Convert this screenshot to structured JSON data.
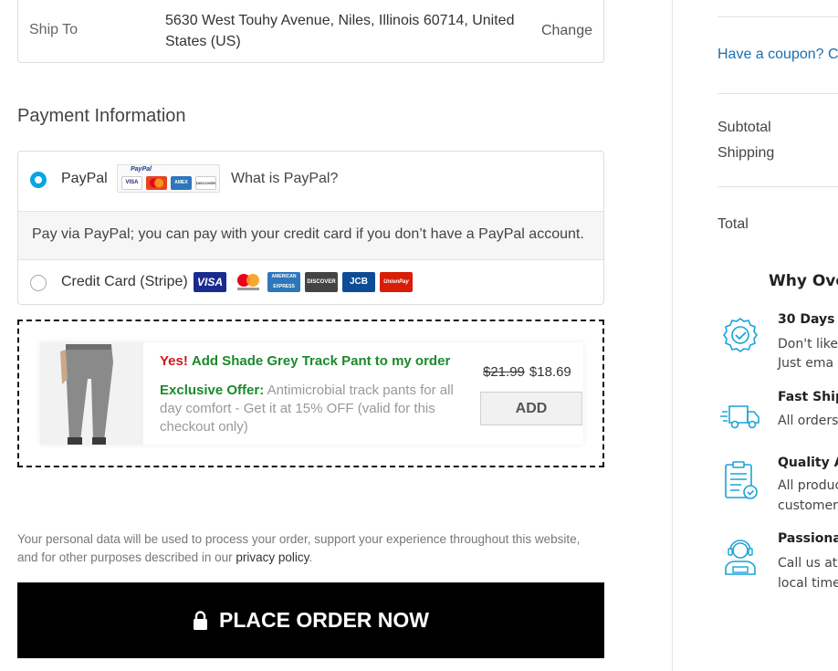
{
  "shipping": {
    "label": "Ship To",
    "address": "5630 West Touhy Avenue, Niles, Illinois 60714, United States (US)",
    "change_label": "Change"
  },
  "payment": {
    "title": "Payment Information",
    "paypal": {
      "label": "PayPal",
      "logo_text": "PayPal",
      "logo_cards": [
        "VISA",
        "MC",
        "AMEX",
        "DISCOVER"
      ],
      "what_is": "What is PayPal?",
      "selected": true,
      "description": "Pay via PayPal; you can pay with your credit card if you don’t have a PayPal account."
    },
    "credit_card": {
      "label": "Credit Card (Stripe)",
      "selected": false,
      "cards": [
        "VISA",
        "mastercard",
        "AMERICAN EXPRESS",
        "DISCOVER",
        "JCB",
        "UnionPay"
      ]
    }
  },
  "offer": {
    "yes": "Yes!",
    "headline": "Add Shade Grey Track Pant to my order",
    "exclusive_label": "Exclusive Offer:",
    "exclusive_text": "Antimicrobial track pants for all day comfort - Get it at 15% OFF (valid for this checkout only)",
    "old_price": "$21.99",
    "new_price": "$18.69",
    "add_label": "ADD"
  },
  "privacy": {
    "text": "Your personal data will be used to process your order, support your experience throughout this website, and for other purposes described in our ",
    "link": "privacy policy",
    "end": "."
  },
  "place_order": {
    "label": "PLACE ORDER NOW"
  },
  "sidebar": {
    "coupon": "Have a coupon? C",
    "subtotal": "Subtotal",
    "shipping": "Shipping",
    "total": "Total",
    "why_title": "Why Ove",
    "features": [
      {
        "icon": "award-badge-icon",
        "title": "30 Days S",
        "lines": [
          "Don't like",
          "Just ema"
        ]
      },
      {
        "icon": "delivery-truck-icon",
        "title": "Fast Ship",
        "lines": [
          "All orders"
        ]
      },
      {
        "icon": "clipboard-check-icon",
        "title": "Quality A",
        "lines": [
          "All produc",
          "customer"
        ]
      },
      {
        "icon": "support-agent-icon",
        "title": "Passiona",
        "lines": [
          "Call us at",
          "local time"
        ]
      }
    ]
  },
  "colors": {
    "accent_blue": "#0aa4e6",
    "link_blue": "#1a6fb0",
    "offer_green": "#1b8a2a",
    "offer_red": "#d01818",
    "button_black": "#000000"
  }
}
